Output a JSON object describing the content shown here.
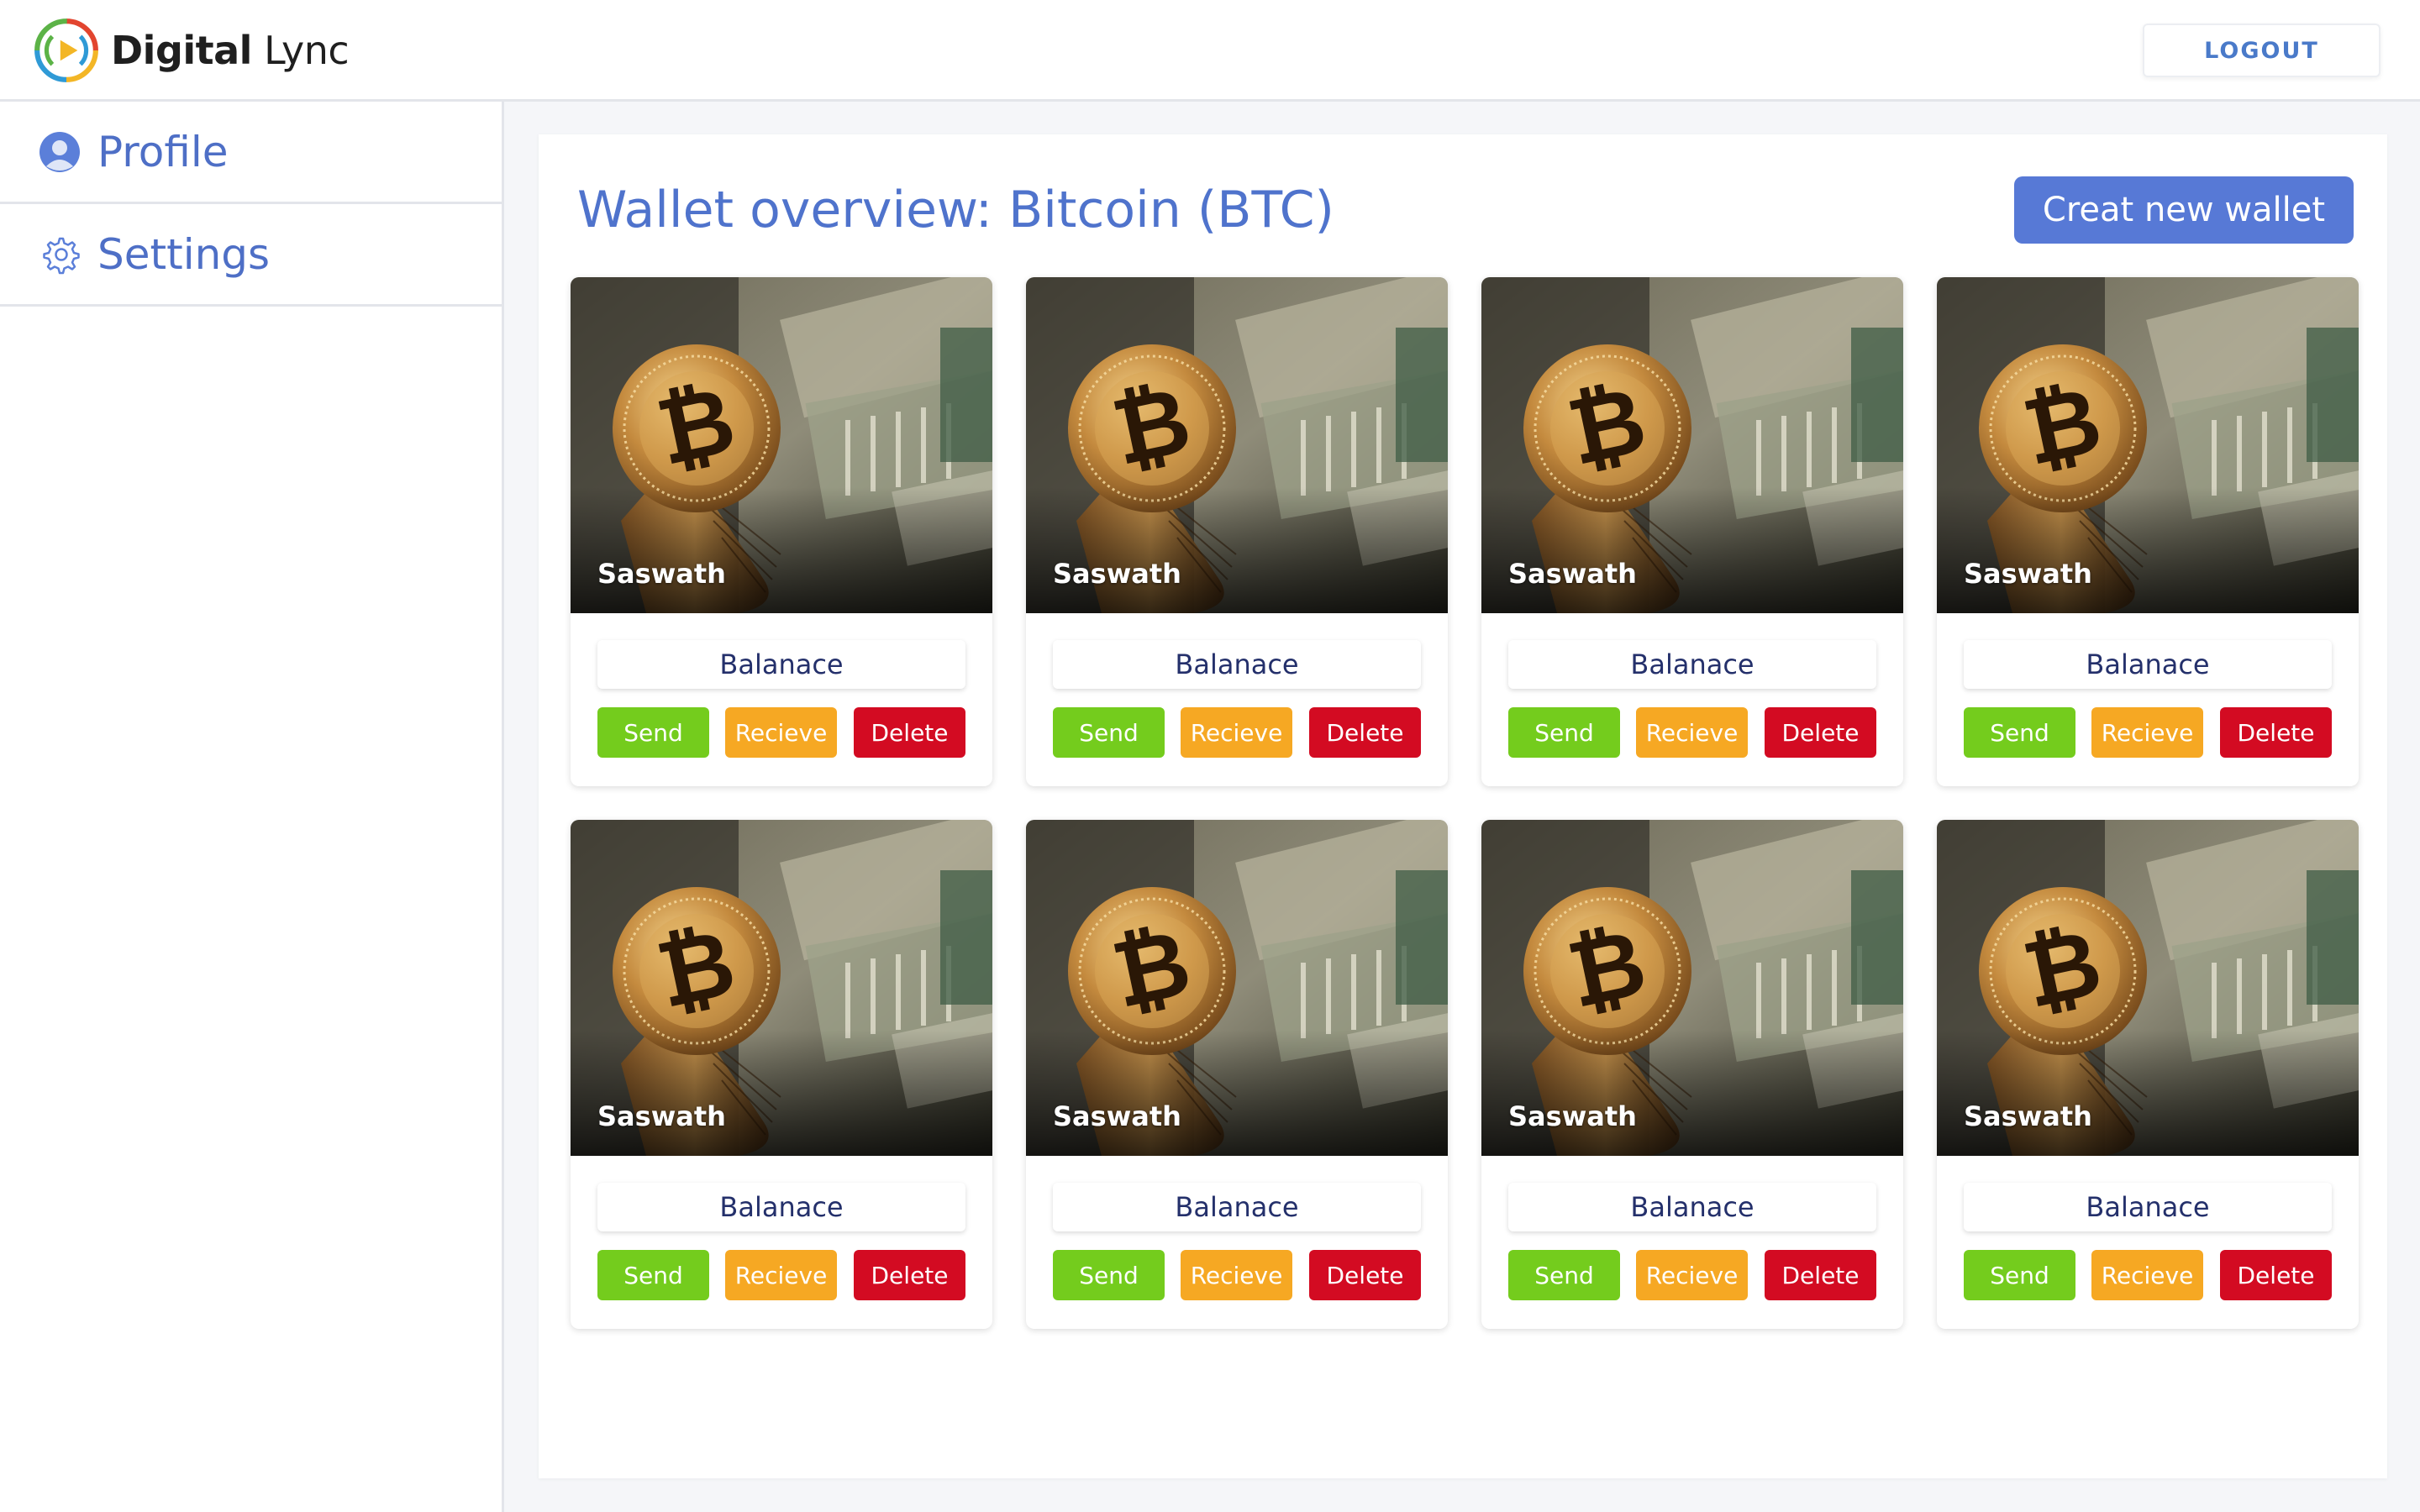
{
  "brand": {
    "bold": "Digital",
    "light": " Lync"
  },
  "header": {
    "logout_label": "LOGOUT"
  },
  "sidebar": {
    "items": [
      {
        "label": "Profile",
        "icon": "user-avatar-icon"
      },
      {
        "label": "Settings",
        "icon": "gear-icon"
      }
    ]
  },
  "main": {
    "title": "Wallet overview: Bitcoin (BTC)",
    "create_label": "Creat new wallet",
    "wallets": [
      {
        "owner": "Saswath",
        "balance_label": "Balanace",
        "send_label": "Send",
        "receive_label": "Recieve",
        "delete_label": "Delete"
      },
      {
        "owner": "Saswath",
        "balance_label": "Balanace",
        "send_label": "Send",
        "receive_label": "Recieve",
        "delete_label": "Delete"
      },
      {
        "owner": "Saswath",
        "balance_label": "Balanace",
        "send_label": "Send",
        "receive_label": "Recieve",
        "delete_label": "Delete"
      },
      {
        "owner": "Saswath",
        "balance_label": "Balanace",
        "send_label": "Send",
        "receive_label": "Recieve",
        "delete_label": "Delete"
      },
      {
        "owner": "Saswath",
        "balance_label": "Balanace",
        "send_label": "Send",
        "receive_label": "Recieve",
        "delete_label": "Delete"
      },
      {
        "owner": "Saswath",
        "balance_label": "Balanace",
        "send_label": "Send",
        "receive_label": "Recieve",
        "delete_label": "Delete"
      },
      {
        "owner": "Saswath",
        "balance_label": "Balanace",
        "send_label": "Send",
        "receive_label": "Recieve",
        "delete_label": "Delete"
      },
      {
        "owner": "Saswath",
        "balance_label": "Balanace",
        "send_label": "Send",
        "receive_label": "Recieve",
        "delete_label": "Delete"
      }
    ]
  },
  "colors": {
    "accent": "#5779d6",
    "title": "#4f73cc",
    "send": "#74cc1d",
    "receive": "#f6a823",
    "delete": "#d30b22",
    "balance_text": "#24306b"
  }
}
